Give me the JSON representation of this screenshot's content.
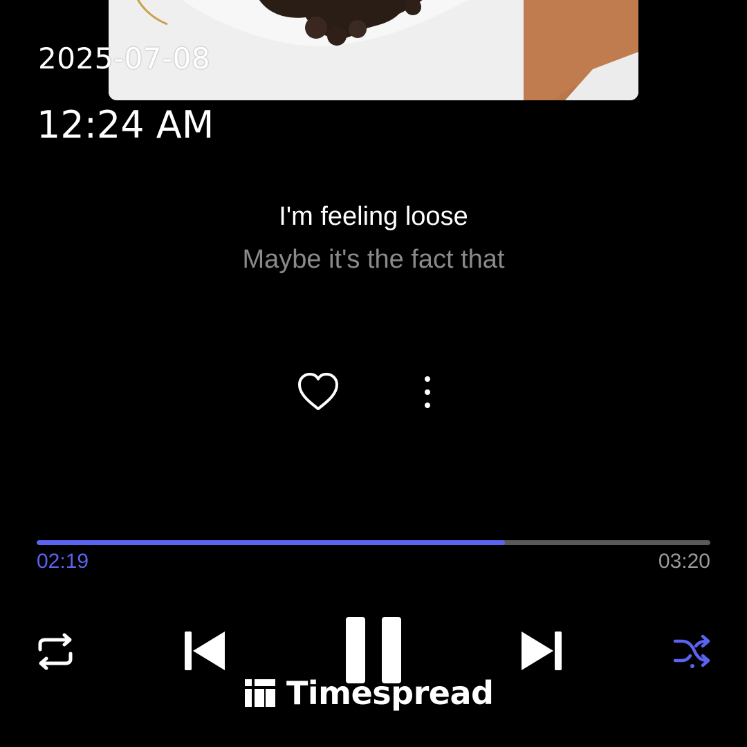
{
  "status": {
    "date": "2025-07-08",
    "time": "12:24 AM"
  },
  "lyrics": {
    "current": "I'm feeling loose",
    "next": "Maybe it's the fact that"
  },
  "actions": {
    "like_icon": "heart-outline-icon",
    "more_icon": "more-vertical-icon"
  },
  "playback": {
    "elapsed": "02:19",
    "total": "03:20",
    "progress_fraction": 0.695
  },
  "controls": {
    "repeat_icon": "repeat-icon",
    "previous_icon": "skip-previous-icon",
    "pause_icon": "pause-icon",
    "next_icon": "skip-next-icon",
    "shuffle_icon": "shuffle-icon"
  },
  "colors": {
    "accent": "#5b63f0",
    "background": "#000000",
    "secondary_text": "#8a8a8a"
  },
  "watermark": {
    "text": "Timespread"
  }
}
